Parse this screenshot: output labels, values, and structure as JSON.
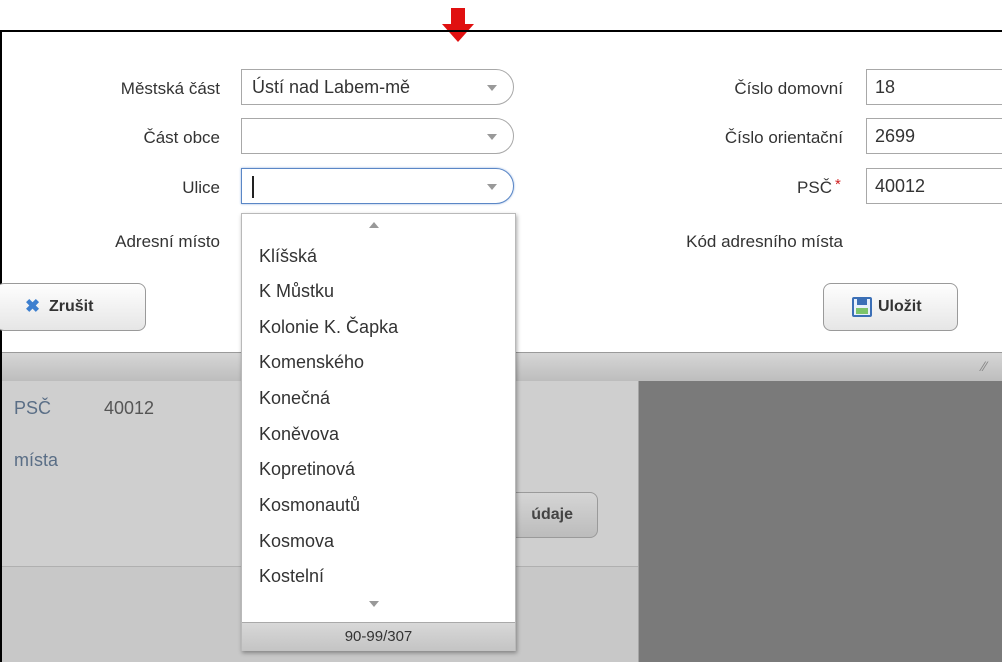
{
  "form": {
    "mestska_cast": {
      "label": "Městská část",
      "value": "Ústí nad Labem-mě"
    },
    "cast_obce": {
      "label": "Část obce",
      "value": ""
    },
    "ulice": {
      "label": "Ulice",
      "value": ""
    },
    "adresni_misto": {
      "label": "Adresní místo"
    },
    "cislo_domovni": {
      "label": "Číslo domovní",
      "value": "18"
    },
    "cislo_orientacni": {
      "label": "Číslo orientační",
      "value": "2699"
    },
    "psc": {
      "label": "PSČ",
      "required_mark": "*",
      "value": "40012"
    },
    "kod_adresniho_mista": {
      "label": "Kód adresního místa"
    }
  },
  "buttons": {
    "cancel_label": "Zrušit",
    "save_label": "Uložit"
  },
  "dropdown": {
    "items": [
      "Klíšská",
      "K Můstku",
      "Kolonie K. Čapka",
      "Komenského",
      "Konečná",
      "Koněvova",
      "Kopretinová",
      "Kosmonautů",
      "Kosmova",
      "Kostelní"
    ],
    "pager": "90-99/307"
  },
  "background": {
    "psc_label": "PSČ",
    "psc_value": "40012",
    "misto_text": "místa",
    "button_text": "údaje"
  },
  "icons": {
    "arrow": "red-down-arrow",
    "cancel": "x-icon",
    "save": "floppy-disk-icon"
  },
  "colors": {
    "annotation_arrow": "#e01010",
    "required": "#d02020",
    "cancel_icon": "#3d7fcf"
  }
}
